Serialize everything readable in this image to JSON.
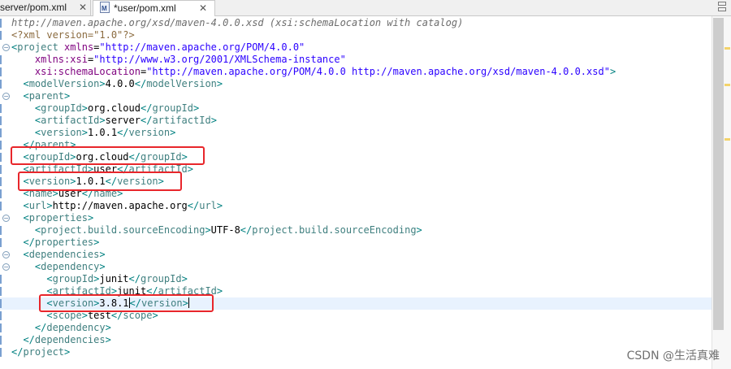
{
  "tabs": [
    {
      "label": "server/pom.xml",
      "active": false
    },
    {
      "label": "*user/pom.xml",
      "active": true
    }
  ],
  "close_glyph": "✕",
  "code_lines": [
    {
      "fold": false,
      "tokens": [
        [
          "c-comment",
          "http://maven.apache.org/xsd/maven-4.0.0.xsd (xsi:schemaLocation with catalog)"
        ]
      ]
    },
    {
      "fold": false,
      "tokens": [
        [
          "c-pi",
          "<?xml version=\"1.0\"?>"
        ]
      ]
    },
    {
      "fold": true,
      "tokens": [
        [
          "c-br",
          "<"
        ],
        [
          "c-tag",
          "project"
        ],
        [
          "c-txt",
          " "
        ],
        [
          "c-attr",
          "xmlns"
        ],
        [
          "c-txt",
          "="
        ],
        [
          "c-val",
          "\"http://maven.apache.org/POM/4.0.0\""
        ]
      ]
    },
    {
      "fold": false,
      "tokens": [
        [
          "c-txt",
          "    "
        ],
        [
          "c-attr",
          "xmlns:xsi"
        ],
        [
          "c-txt",
          "="
        ],
        [
          "c-val",
          "\"http://www.w3.org/2001/XMLSchema-instance\""
        ]
      ]
    },
    {
      "fold": false,
      "tokens": [
        [
          "c-txt",
          "    "
        ],
        [
          "c-attr",
          "xsi:schemaLocation"
        ],
        [
          "c-txt",
          "="
        ],
        [
          "c-val",
          "\"http://maven.apache.org/POM/4.0.0 http://maven.apache.org/xsd/maven-4.0.0.xsd\""
        ],
        [
          "c-br",
          ">"
        ]
      ]
    },
    {
      "fold": false,
      "tokens": [
        [
          "c-txt",
          "  "
        ],
        [
          "c-br",
          "<"
        ],
        [
          "c-tag",
          "modelVersion"
        ],
        [
          "c-br",
          ">"
        ],
        [
          "c-txt",
          "4.0.0"
        ],
        [
          "c-br",
          "</"
        ],
        [
          "c-tag",
          "modelVersion"
        ],
        [
          "c-br",
          ">"
        ]
      ]
    },
    {
      "fold": true,
      "tokens": [
        [
          "c-txt",
          "  "
        ],
        [
          "c-br",
          "<"
        ],
        [
          "c-tag",
          "parent"
        ],
        [
          "c-br",
          ">"
        ]
      ]
    },
    {
      "fold": false,
      "tokens": [
        [
          "c-txt",
          "    "
        ],
        [
          "c-br",
          "<"
        ],
        [
          "c-tag",
          "groupId"
        ],
        [
          "c-br",
          ">"
        ],
        [
          "c-txt",
          "org.cloud"
        ],
        [
          "c-br",
          "</"
        ],
        [
          "c-tag",
          "groupId"
        ],
        [
          "c-br",
          ">"
        ]
      ]
    },
    {
      "fold": false,
      "tokens": [
        [
          "c-txt",
          "    "
        ],
        [
          "c-br",
          "<"
        ],
        [
          "c-tag",
          "artifactId"
        ],
        [
          "c-br",
          ">"
        ],
        [
          "c-txt",
          "server"
        ],
        [
          "c-br",
          "</"
        ],
        [
          "c-tag",
          "artifactId"
        ],
        [
          "c-br",
          ">"
        ]
      ]
    },
    {
      "fold": false,
      "tokens": [
        [
          "c-txt",
          "    "
        ],
        [
          "c-br",
          "<"
        ],
        [
          "c-tag",
          "version"
        ],
        [
          "c-br",
          ">"
        ],
        [
          "c-txt",
          "1.0.1"
        ],
        [
          "c-br",
          "</"
        ],
        [
          "c-tag",
          "version"
        ],
        [
          "c-br",
          ">"
        ]
      ]
    },
    {
      "fold": false,
      "tokens": [
        [
          "c-txt",
          "  "
        ],
        [
          "c-br",
          "</"
        ],
        [
          "c-tag",
          "parent"
        ],
        [
          "c-br",
          ">"
        ]
      ]
    },
    {
      "fold": false,
      "tokens": [
        [
          "c-txt",
          "  "
        ],
        [
          "c-br",
          "<"
        ],
        [
          "c-tag",
          "groupId"
        ],
        [
          "c-br",
          ">"
        ],
        [
          "c-txt",
          "org.cloud"
        ],
        [
          "c-br",
          "</"
        ],
        [
          "c-tag",
          "groupId"
        ],
        [
          "c-br",
          ">"
        ]
      ]
    },
    {
      "fold": false,
      "tokens": [
        [
          "c-txt",
          "  "
        ],
        [
          "c-br",
          "<"
        ],
        [
          "c-tag",
          "artifactId"
        ],
        [
          "c-br",
          ">"
        ],
        [
          "c-txt",
          "user"
        ],
        [
          "c-br",
          "</"
        ],
        [
          "c-tag",
          "artifactId"
        ],
        [
          "c-br",
          ">"
        ]
      ]
    },
    {
      "fold": false,
      "tokens": [
        [
          "c-txt",
          "  "
        ],
        [
          "c-br",
          "<"
        ],
        [
          "c-tag",
          "version"
        ],
        [
          "c-br",
          ">"
        ],
        [
          "c-txt",
          "1.0.1"
        ],
        [
          "c-br",
          "</"
        ],
        [
          "c-tag",
          "version"
        ],
        [
          "c-br",
          ">"
        ]
      ]
    },
    {
      "fold": false,
      "tokens": [
        [
          "c-txt",
          "  "
        ],
        [
          "c-br",
          "<"
        ],
        [
          "c-tag",
          "name"
        ],
        [
          "c-br",
          ">"
        ],
        [
          "c-txt",
          "user"
        ],
        [
          "c-br",
          "</"
        ],
        [
          "c-tag",
          "name"
        ],
        [
          "c-br",
          ">"
        ]
      ]
    },
    {
      "fold": false,
      "tokens": [
        [
          "c-txt",
          "  "
        ],
        [
          "c-br",
          "<"
        ],
        [
          "c-tag",
          "url"
        ],
        [
          "c-br",
          ">"
        ],
        [
          "c-txt",
          "http://maven.apache.org"
        ],
        [
          "c-br",
          "</"
        ],
        [
          "c-tag",
          "url"
        ],
        [
          "c-br",
          ">"
        ]
      ]
    },
    {
      "fold": true,
      "tokens": [
        [
          "c-txt",
          "  "
        ],
        [
          "c-br",
          "<"
        ],
        [
          "c-tag",
          "properties"
        ],
        [
          "c-br",
          ">"
        ]
      ]
    },
    {
      "fold": false,
      "tokens": [
        [
          "c-txt",
          "    "
        ],
        [
          "c-br",
          "<"
        ],
        [
          "c-tag",
          "project.build.sourceEncoding"
        ],
        [
          "c-br",
          ">"
        ],
        [
          "c-txt",
          "UTF-8"
        ],
        [
          "c-br",
          "</"
        ],
        [
          "c-tag",
          "project.build.sourceEncoding"
        ],
        [
          "c-br",
          ">"
        ]
      ]
    },
    {
      "fold": false,
      "tokens": [
        [
          "c-txt",
          "  "
        ],
        [
          "c-br",
          "</"
        ],
        [
          "c-tag",
          "properties"
        ],
        [
          "c-br",
          ">"
        ]
      ]
    },
    {
      "fold": true,
      "tokens": [
        [
          "c-txt",
          "  "
        ],
        [
          "c-br",
          "<"
        ],
        [
          "c-tag",
          "dependencies"
        ],
        [
          "c-br",
          ">"
        ]
      ]
    },
    {
      "fold": true,
      "tokens": [
        [
          "c-txt",
          "    "
        ],
        [
          "c-br",
          "<"
        ],
        [
          "c-tag",
          "dependency"
        ],
        [
          "c-br",
          ">"
        ]
      ]
    },
    {
      "fold": false,
      "tokens": [
        [
          "c-txt",
          "      "
        ],
        [
          "c-br",
          "<"
        ],
        [
          "c-tag",
          "groupId"
        ],
        [
          "c-br",
          ">"
        ],
        [
          "c-txt",
          "junit"
        ],
        [
          "c-br",
          "</"
        ],
        [
          "c-tag",
          "groupId"
        ],
        [
          "c-br",
          ">"
        ]
      ]
    },
    {
      "fold": false,
      "tokens": [
        [
          "c-txt",
          "      "
        ],
        [
          "c-br",
          "<"
        ],
        [
          "c-tag",
          "artifactId"
        ],
        [
          "c-br",
          ">"
        ],
        [
          "c-txt",
          "junit"
        ],
        [
          "c-br",
          "</"
        ],
        [
          "c-tag",
          "artifactId"
        ],
        [
          "c-br",
          ">"
        ]
      ]
    },
    {
      "fold": false,
      "current": true,
      "tokens": [
        [
          "c-txt",
          "      "
        ],
        [
          "c-br",
          "<"
        ],
        [
          "c-tag",
          "version"
        ],
        [
          "c-br",
          ">"
        ],
        [
          "c-txt",
          "3.8.1"
        ],
        [
          "caret",
          ""
        ],
        [
          "c-br",
          "</"
        ],
        [
          "c-tag",
          "version"
        ],
        [
          "c-br",
          ">"
        ],
        [
          "caret",
          ""
        ]
      ]
    },
    {
      "fold": false,
      "tokens": [
        [
          "c-txt",
          "      "
        ],
        [
          "c-br",
          "<"
        ],
        [
          "c-tag",
          "scope"
        ],
        [
          "c-br",
          ">"
        ],
        [
          "c-txt",
          "test"
        ],
        [
          "c-br",
          "</"
        ],
        [
          "c-tag",
          "scope"
        ],
        [
          "c-br",
          ">"
        ]
      ]
    },
    {
      "fold": false,
      "tokens": [
        [
          "c-txt",
          "    "
        ],
        [
          "c-br",
          "</"
        ],
        [
          "c-tag",
          "dependency"
        ],
        [
          "c-br",
          ">"
        ]
      ]
    },
    {
      "fold": false,
      "tokens": [
        [
          "c-txt",
          "  "
        ],
        [
          "c-br",
          "</"
        ],
        [
          "c-tag",
          "dependencies"
        ],
        [
          "c-br",
          ">"
        ]
      ]
    },
    {
      "fold": false,
      "tokens": [
        [
          "c-br",
          "</"
        ],
        [
          "c-tag",
          "project"
        ],
        [
          "c-br",
          ">"
        ]
      ]
    }
  ],
  "watermark": "CSDN @生活真难",
  "colors": {
    "highlight": "#e8262b",
    "current_line": "#e8f2fe",
    "overview_mark": "#f3d36b"
  }
}
